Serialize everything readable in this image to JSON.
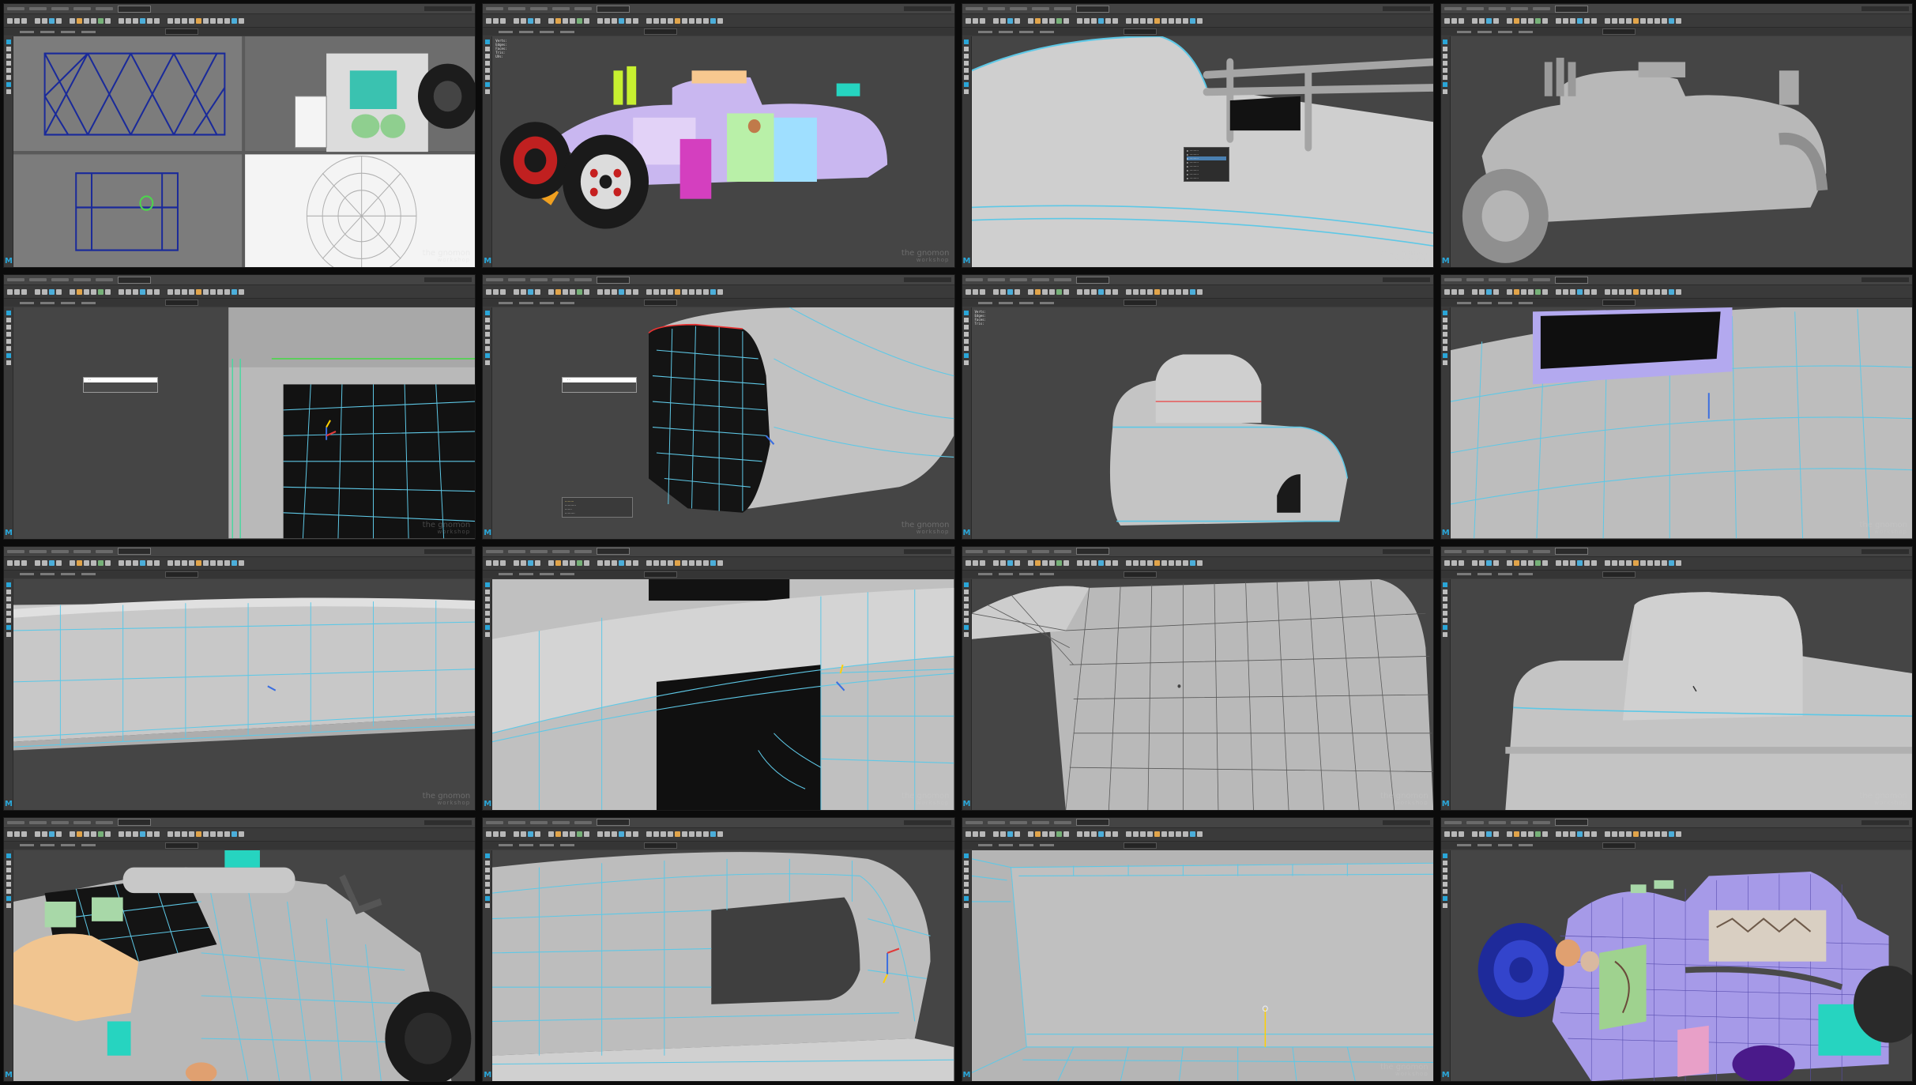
{
  "grid": {
    "columns": 4,
    "rows": 4
  },
  "app": {
    "badge": "",
    "logo": "M",
    "watermark_top": "the gnomon",
    "watermark_bottom": "workshop"
  },
  "hud": {
    "rows": [
      {
        "k": "Verts:",
        "v": ""
      },
      {
        "k": "Edges:",
        "v": ""
      },
      {
        "k": "Faces:",
        "v": ""
      },
      {
        "k": "Tris:",
        "v": ""
      },
      {
        "k": "UVs:",
        "v": ""
      }
    ]
  },
  "colors": {
    "viewport_bg": "#454545",
    "surface": "#bdbdbd",
    "wire": "#5ec8e6",
    "selection": "#3a9ad9",
    "maya_blue": "#2aa6d8",
    "panel_gap": "#0b0b0b"
  },
  "panels": [
    {
      "id": 1,
      "view": "quad-view-blueprint",
      "desc": ""
    },
    {
      "id": 2,
      "view": "hotrod-colored-shells"
    },
    {
      "id": 3,
      "view": "marking-menu-body"
    },
    {
      "id": 4,
      "view": "grey-hotrod-model"
    },
    {
      "id": 5,
      "view": "window-opening-closeup"
    },
    {
      "id": 6,
      "view": "wheel-arch-cutout"
    },
    {
      "id": 7,
      "view": "cab-body-blockout"
    },
    {
      "id": 8,
      "view": "roof-opening-top"
    },
    {
      "id": 9,
      "view": "side-panel-edge"
    },
    {
      "id": 10,
      "view": "door-opening-wire"
    },
    {
      "id": 11,
      "view": "cab-wireframe-smooth"
    },
    {
      "id": 12,
      "view": "cab-smooth-grey"
    },
    {
      "id": 13,
      "view": "cab-interior-seats"
    },
    {
      "id": 14,
      "view": "roof-hole-top"
    },
    {
      "id": 15,
      "view": "floor-edge-loops"
    },
    {
      "id": 16,
      "view": "uv-checker-car"
    }
  ]
}
